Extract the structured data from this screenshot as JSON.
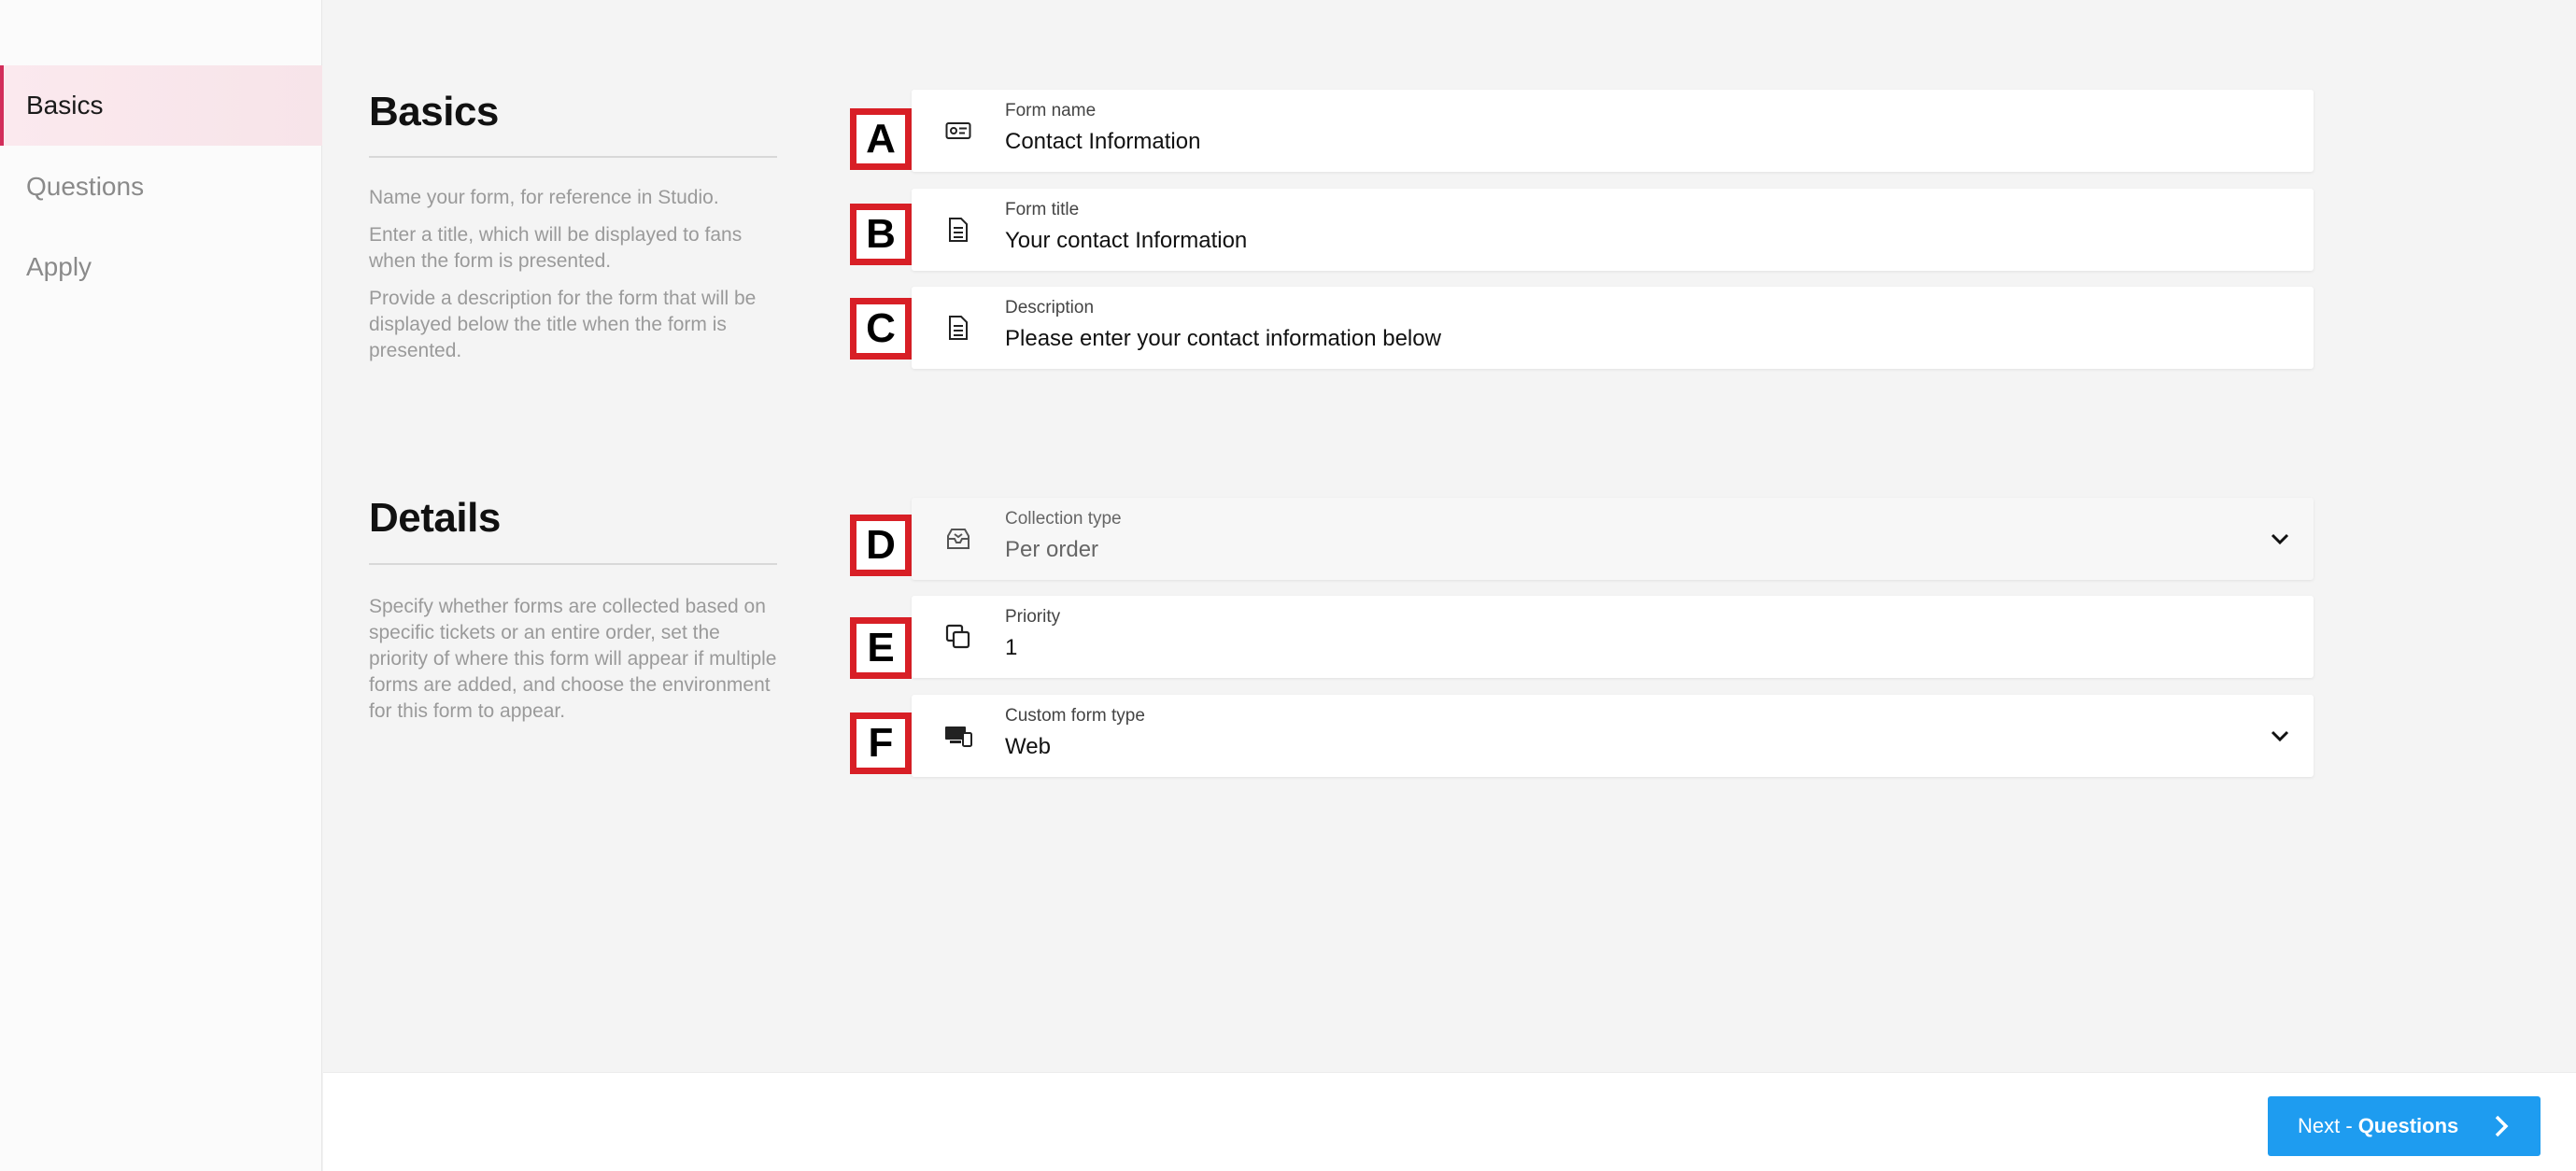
{
  "sidebar": {
    "items": [
      {
        "label": "Basics",
        "active": true
      },
      {
        "label": "Questions",
        "active": false
      },
      {
        "label": "Apply",
        "active": false
      }
    ]
  },
  "basics": {
    "title": "Basics",
    "help": [
      "Name your form, for reference in Studio.",
      "Enter a title, which will be displayed to fans when the form is presented.",
      "Provide a description for the form that will be displayed below the title when the form is presented."
    ],
    "fields": [
      {
        "marker": "A",
        "icon": "id-card-icon",
        "label": "Form name",
        "value": "Contact Information"
      },
      {
        "marker": "B",
        "icon": "document-icon",
        "label": "Form title",
        "value": "Your contact Information"
      },
      {
        "marker": "C",
        "icon": "document-icon",
        "label": "Description",
        "value": "Please enter your contact information below"
      }
    ]
  },
  "details": {
    "title": "Details",
    "help": "Specify whether forms are collected based on specific tickets or an entire order, set the priority of where this form will appear if multiple forms are added, and choose the environment for this form to appear.",
    "fields": [
      {
        "marker": "D",
        "icon": "inbox-icon",
        "label": "Collection type",
        "value": "Per order",
        "dropdown": true,
        "disabled": true
      },
      {
        "marker": "E",
        "icon": "copy-icon",
        "label": "Priority",
        "value": "1"
      },
      {
        "marker": "F",
        "icon": "devices-icon",
        "label": "Custom form type",
        "value": "Web",
        "dropdown": true
      }
    ]
  },
  "footer": {
    "next_prefix": "Next - ",
    "next_strong": "Questions"
  },
  "colors": {
    "accent": "#1e9cf0",
    "active_nav": "#d22d5a",
    "marker": "#d81f26"
  }
}
